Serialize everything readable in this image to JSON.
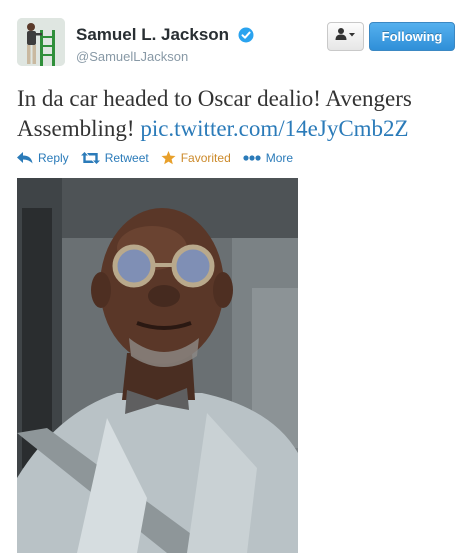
{
  "user": {
    "name": "Samuel L. Jackson",
    "screen_name": "@SamuelLJackson"
  },
  "buttons": {
    "follow_label": "Following"
  },
  "tweet": {
    "text": "In da car headed to Oscar dealio! Avengers Assembling!",
    "link": "pic.twitter.com/14eJyCmb2Z"
  },
  "actions": {
    "reply": "Reply",
    "retweet": "Retweet",
    "favorited": "Favorited",
    "more": "More"
  },
  "colors": {
    "link": "#2b7bb9",
    "favorited": "#cc8a2b",
    "follow_button": "#3a96e0"
  },
  "icons": [
    "verified-badge-icon",
    "user-dropdown-icon",
    "reply-icon",
    "retweet-icon",
    "star-icon",
    "more-dots-icon"
  ]
}
